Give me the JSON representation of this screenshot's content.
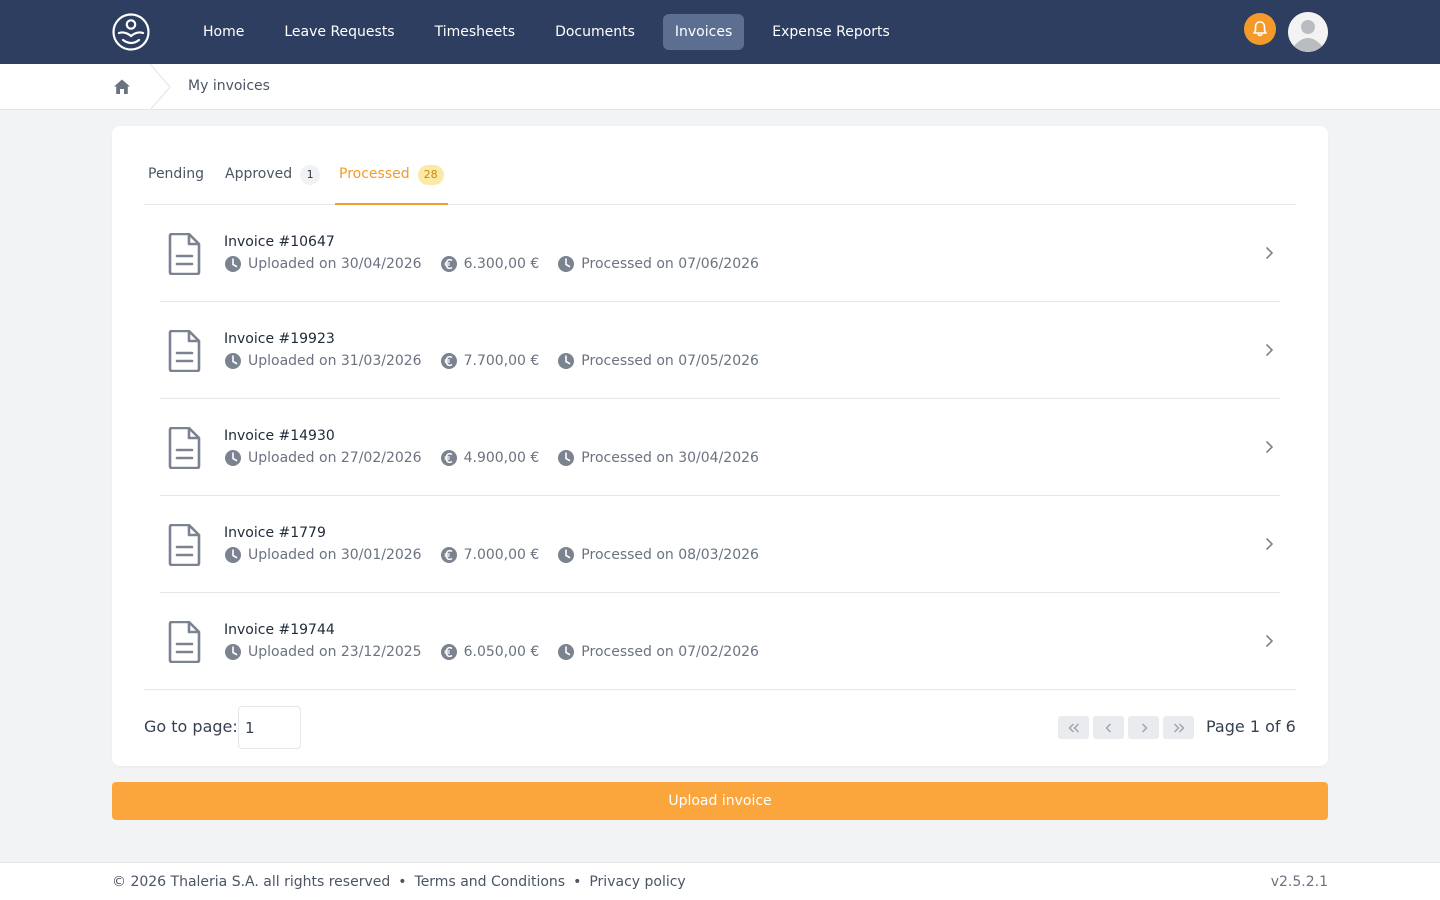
{
  "nav": {
    "items": [
      {
        "label": "Home",
        "active": false
      },
      {
        "label": "Leave Requests",
        "active": false
      },
      {
        "label": "Timesheets",
        "active": false
      },
      {
        "label": "Documents",
        "active": false
      },
      {
        "label": "Invoices",
        "active": true
      },
      {
        "label": "Expense Reports",
        "active": false
      }
    ]
  },
  "breadcrumb": {
    "current": "My invoices"
  },
  "tabs": [
    {
      "label": "Pending",
      "count": ""
    },
    {
      "label": "Approved",
      "count": "1"
    },
    {
      "label": "Processed",
      "count": "28",
      "active": true
    }
  ],
  "invoices": [
    {
      "title": "Invoice #10647",
      "uploaded": "Uploaded on 30/04/2026",
      "amount": "6.300,00 €",
      "processed": "Processed on 07/06/2026"
    },
    {
      "title": "Invoice #19923",
      "uploaded": "Uploaded on 31/03/2026",
      "amount": "7.700,00 €",
      "processed": "Processed on 07/05/2026"
    },
    {
      "title": "Invoice #14930",
      "uploaded": "Uploaded on 27/02/2026",
      "amount": "4.900,00 €",
      "processed": "Processed on 30/04/2026"
    },
    {
      "title": "Invoice #1779",
      "uploaded": "Uploaded on 30/01/2026",
      "amount": "7.000,00 €",
      "processed": "Processed on 08/03/2026"
    },
    {
      "title": "Invoice #19744",
      "uploaded": "Uploaded on 23/12/2025",
      "amount": "6.050,00 €",
      "processed": "Processed on 07/02/2026"
    }
  ],
  "pagination": {
    "goto_label": "Go to page:",
    "goto_value": "1",
    "page_text": "Page 1 of 6"
  },
  "upload_button": "Upload invoice",
  "footer": {
    "copyright": "© 2026 Thaleria S.A. all rights reserved",
    "terms": "Terms and Conditions",
    "privacy": "Privacy policy",
    "separator": "•",
    "version": "v2.5.2.1"
  },
  "colors": {
    "nav_bg": "#2d3e60",
    "accent": "#f39a2b",
    "upload_bg": "#fba63c",
    "badge_yellow": "#fde9a6"
  }
}
